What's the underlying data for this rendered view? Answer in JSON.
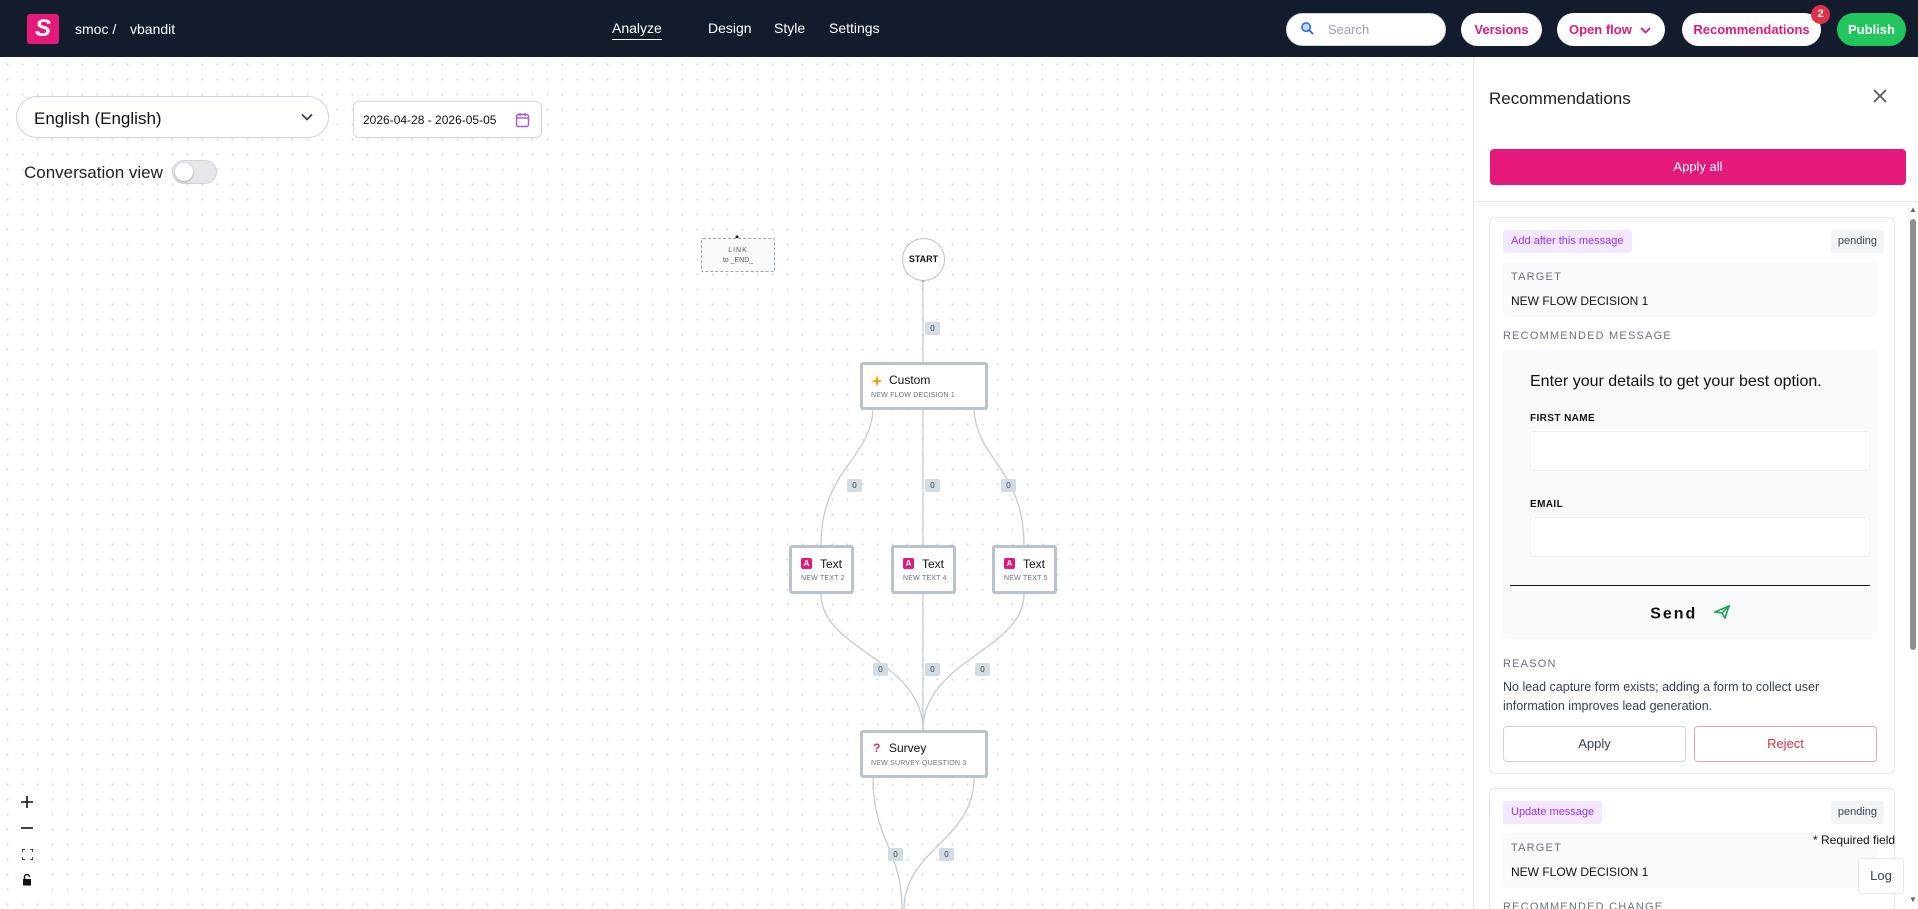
{
  "topbar": {
    "logo_letter": "S",
    "org": "smoc /",
    "project": "vbandit",
    "tabs": [
      {
        "label": "Analyze",
        "active": true
      },
      {
        "label": "Design",
        "active": false
      },
      {
        "label": "Style",
        "active": false
      },
      {
        "label": "Settings",
        "active": false
      }
    ],
    "search_placeholder": "Search",
    "versions_label": "Versions",
    "open_flow_label": "Open flow",
    "recommendations_label": "Recommendations",
    "recommendations_count": "2",
    "publish_label": "Publish"
  },
  "canvas": {
    "language": "English (English)",
    "date_range": "2026-04-28 - 2026-05-05",
    "conversation_view_label": "Conversation view",
    "conversation_view_on": false,
    "nodes": {
      "start": "START",
      "link_title": "LINK",
      "link_target": "to _END_",
      "custom": {
        "title": "Custom",
        "subtitle": "NEW FLOW DECISION 1"
      },
      "text2": {
        "title": "Text",
        "subtitle": "NEW TEXT 2"
      },
      "text4": {
        "title": "Text",
        "subtitle": "NEW TEXT 4"
      },
      "text5": {
        "title": "Text",
        "subtitle": "NEW TEXT 5"
      },
      "survey": {
        "title": "Survey",
        "subtitle": "NEW SURVEY QUESTION 3"
      }
    },
    "edge_counts": [
      "0",
      "0",
      "0",
      "0",
      "0",
      "0",
      "0",
      "0",
      "0"
    ]
  },
  "panel": {
    "title": "Recommendations",
    "apply_all_label": "Apply all",
    "cards": [
      {
        "type": "Add after this message",
        "status": "pending",
        "target_label": "TARGET",
        "target": "NEW FLOW DECISION 1",
        "recommended_label": "RECOMMENDED MESSAGE",
        "preview": {
          "heading": "Enter your details to get your best option.",
          "field1": "FIRST NAME",
          "field2": "EMAIL",
          "send": "Send"
        },
        "reason_label": "REASON",
        "reason": "No lead capture form exists; adding a form to collect user information improves lead generation.",
        "apply_label": "Apply",
        "reject_label": "Reject"
      },
      {
        "type": "Update message",
        "status": "pending",
        "target_label": "TARGET",
        "target": "NEW FLOW DECISION 1",
        "recommended_label": "RECOMMENDED CHANGE"
      }
    ]
  },
  "footer": {
    "required_note": "* Required field",
    "log_label": "Log"
  },
  "colors": {
    "topbar_bg": "#121c2c",
    "brand_pink": "#e5197a",
    "publish_green": "#22c55e",
    "badge_red": "#e0314b",
    "tag_purple": "#9333ea"
  }
}
